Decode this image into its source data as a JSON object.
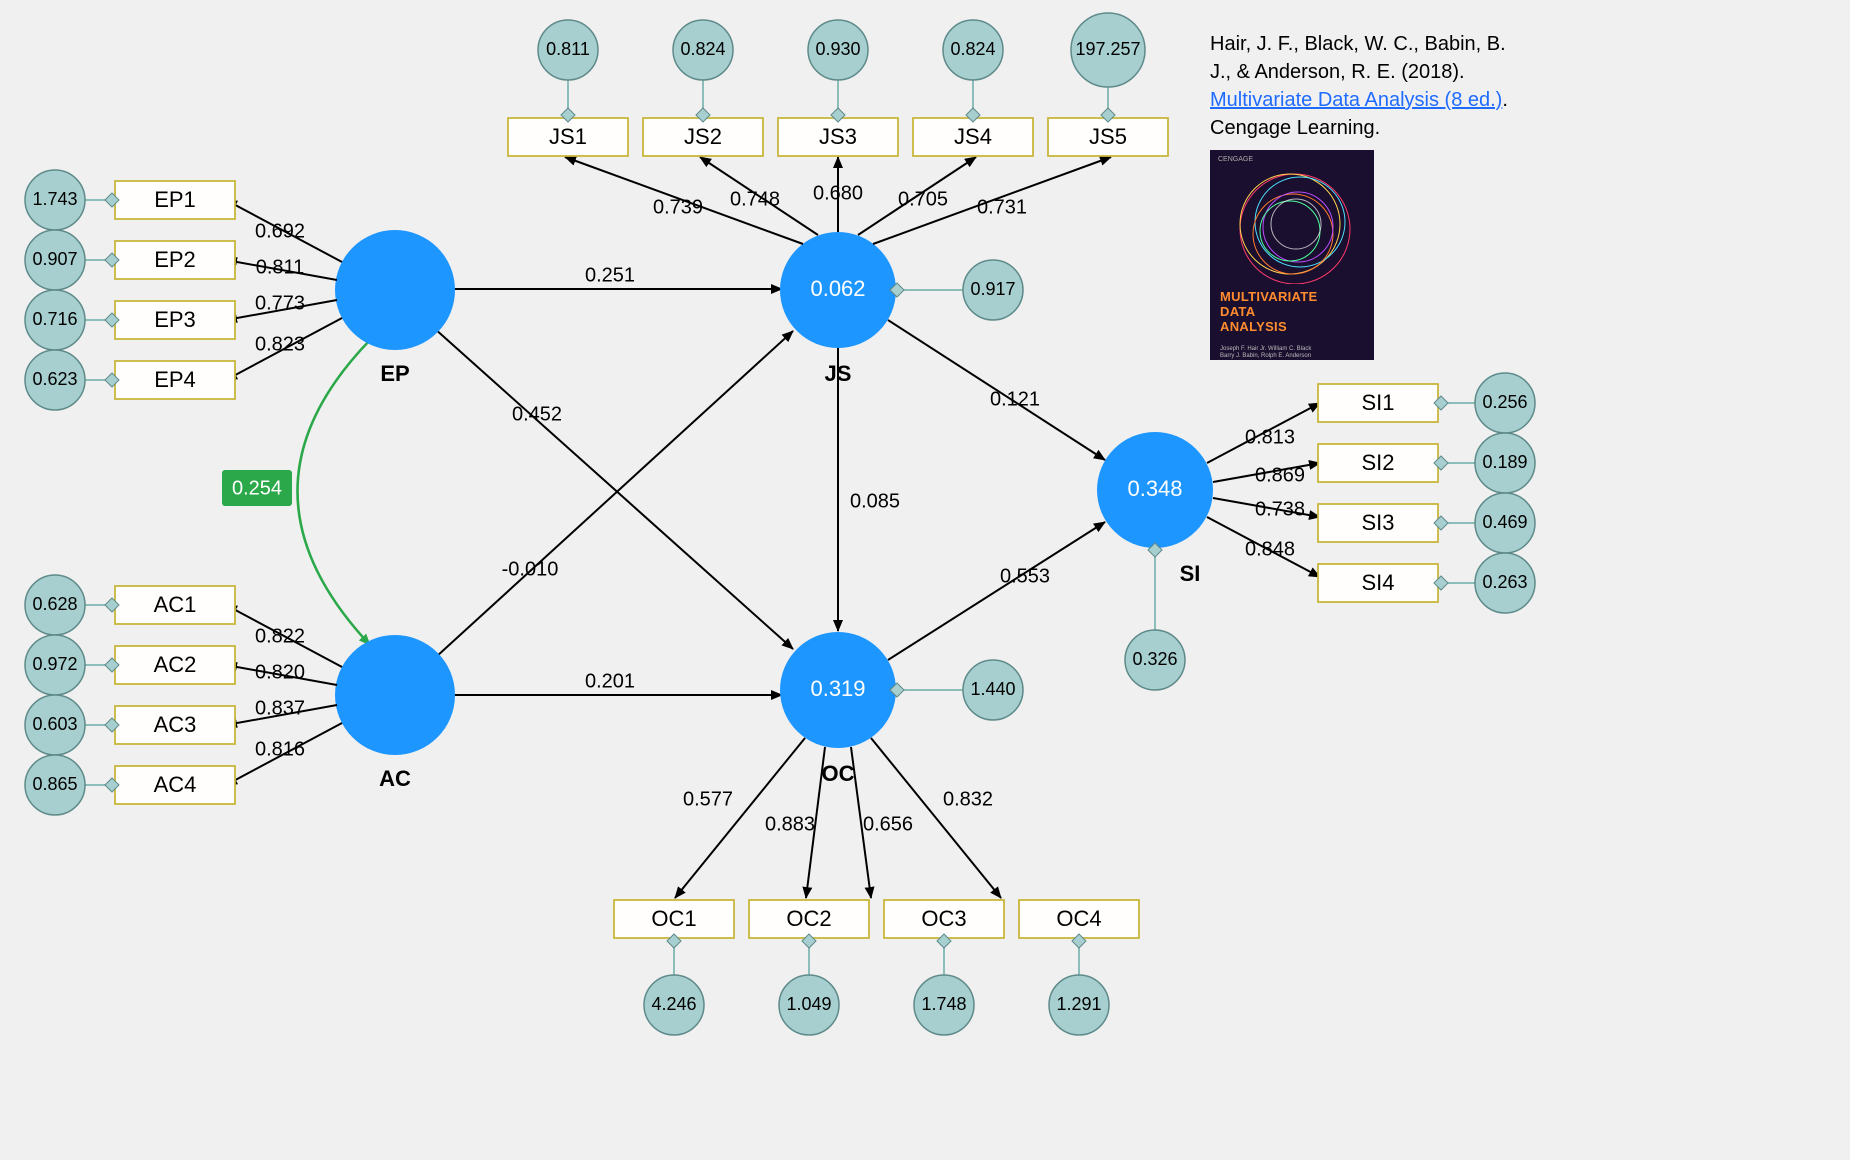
{
  "citation": {
    "authors": "Hair, J. F., Black, W. C., Babin, B. J., & Anderson, R. E. (2018). ",
    "link_text": "Multivariate Data Analysis (8 ed.)",
    "publisher": ". Cengage Learning."
  },
  "book_cover": {
    "publisher_top": "CENGAGE",
    "title": "MULTIVARIATE\nDATA\nANALYSIS",
    "authors": "Joseph F. Hair Jr. William C. Black\nBarry J. Babin, Rolph E. Anderson"
  },
  "latent": {
    "EP": {
      "label": "EP"
    },
    "AC": {
      "label": "AC"
    },
    "JS": {
      "label": "JS",
      "value": "0.062",
      "err": "0.917"
    },
    "OC": {
      "label": "OC",
      "value": "0.319",
      "err": "1.440"
    },
    "SI": {
      "label": "SI",
      "value": "0.348",
      "err": "0.326"
    }
  },
  "covariance": {
    "EP_AC": "0.254"
  },
  "structural": {
    "EP_JS": "0.251",
    "EP_OC": "0.452",
    "AC_JS": "-0.010",
    "AC_OC": "0.201",
    "JS_OC": "0.085",
    "JS_SI": "0.121",
    "OC_SI": "0.553"
  },
  "indicators": {
    "EP": [
      {
        "name": "EP1",
        "loading": "0.692",
        "err": "1.743"
      },
      {
        "name": "EP2",
        "loading": "0.811",
        "err": "0.907"
      },
      {
        "name": "EP3",
        "loading": "0.773",
        "err": "0.716"
      },
      {
        "name": "EP4",
        "loading": "0.823",
        "err": "0.623"
      }
    ],
    "AC": [
      {
        "name": "AC1",
        "loading": "0.822",
        "err": "0.628"
      },
      {
        "name": "AC2",
        "loading": "0.820",
        "err": "0.972"
      },
      {
        "name": "AC3",
        "loading": "0.837",
        "err": "0.603"
      },
      {
        "name": "AC4",
        "loading": "0.816",
        "err": "0.865"
      }
    ],
    "JS": [
      {
        "name": "JS1",
        "loading": "0.739",
        "err": "0.811"
      },
      {
        "name": "JS2",
        "loading": "0.748",
        "err": "0.824"
      },
      {
        "name": "JS3",
        "loading": "0.680",
        "err": "0.930"
      },
      {
        "name": "JS4",
        "loading": "0.705",
        "err": "0.824"
      },
      {
        "name": "JS5",
        "loading": "0.731",
        "err": "197.257"
      }
    ],
    "OC": [
      {
        "name": "OC1",
        "loading": "0.577",
        "err": "4.246"
      },
      {
        "name": "OC2",
        "loading": "0.883",
        "err": "1.049"
      },
      {
        "name": "OC3",
        "loading": "0.656",
        "err": "1.748"
      },
      {
        "name": "OC4",
        "loading": "0.832",
        "err": "1.291"
      }
    ],
    "SI": [
      {
        "name": "SI1",
        "loading": "0.813",
        "err": "0.256"
      },
      {
        "name": "SI2",
        "loading": "0.869",
        "err": "0.189"
      },
      {
        "name": "SI3",
        "loading": "0.738",
        "err": "0.469"
      },
      {
        "name": "SI4",
        "loading": "0.848",
        "err": "0.263"
      }
    ]
  },
  "chart_data": {
    "type": "diagram",
    "description": "Structural Equation Model path diagram",
    "latent_variables": [
      "EP",
      "AC",
      "JS",
      "OC",
      "SI"
    ],
    "r_squared": {
      "JS": 0.062,
      "OC": 0.319,
      "SI": 0.348
    },
    "latent_error_variances": {
      "JS": 0.917,
      "OC": 1.44,
      "SI": 0.326
    },
    "exogenous_covariances": {
      "EP~~AC": 0.254
    },
    "structural_paths": {
      "EP->JS": 0.251,
      "EP->OC": 0.452,
      "AC->JS": -0.01,
      "AC->OC": 0.201,
      "JS->OC": 0.085,
      "JS->SI": 0.121,
      "OC->SI": 0.553
    },
    "measurement_model": {
      "EP": {
        "EP1": 0.692,
        "EP2": 0.811,
        "EP3": 0.773,
        "EP4": 0.823
      },
      "AC": {
        "AC1": 0.822,
        "AC2": 0.82,
        "AC3": 0.837,
        "AC4": 0.816
      },
      "JS": {
        "JS1": 0.739,
        "JS2": 0.748,
        "JS3": 0.68,
        "JS4": 0.705,
        "JS5": 0.731
      },
      "OC": {
        "OC1": 0.577,
        "OC2": 0.883,
        "OC3": 0.656,
        "OC4": 0.832
      },
      "SI": {
        "SI1": 0.813,
        "SI2": 0.869,
        "SI3": 0.738,
        "SI4": 0.848
      }
    },
    "indicator_error_variances": {
      "EP1": 1.743,
      "EP2": 0.907,
      "EP3": 0.716,
      "EP4": 0.623,
      "AC1": 0.628,
      "AC2": 0.972,
      "AC3": 0.603,
      "AC4": 0.865,
      "JS1": 0.811,
      "JS2": 0.824,
      "JS3": 0.93,
      "JS4": 0.824,
      "JS5": 197.257,
      "OC1": 4.246,
      "OC2": 1.049,
      "OC3": 1.748,
      "OC4": 1.291,
      "SI1": 0.256,
      "SI2": 0.189,
      "SI3": 0.469,
      "SI4": 0.263
    }
  }
}
